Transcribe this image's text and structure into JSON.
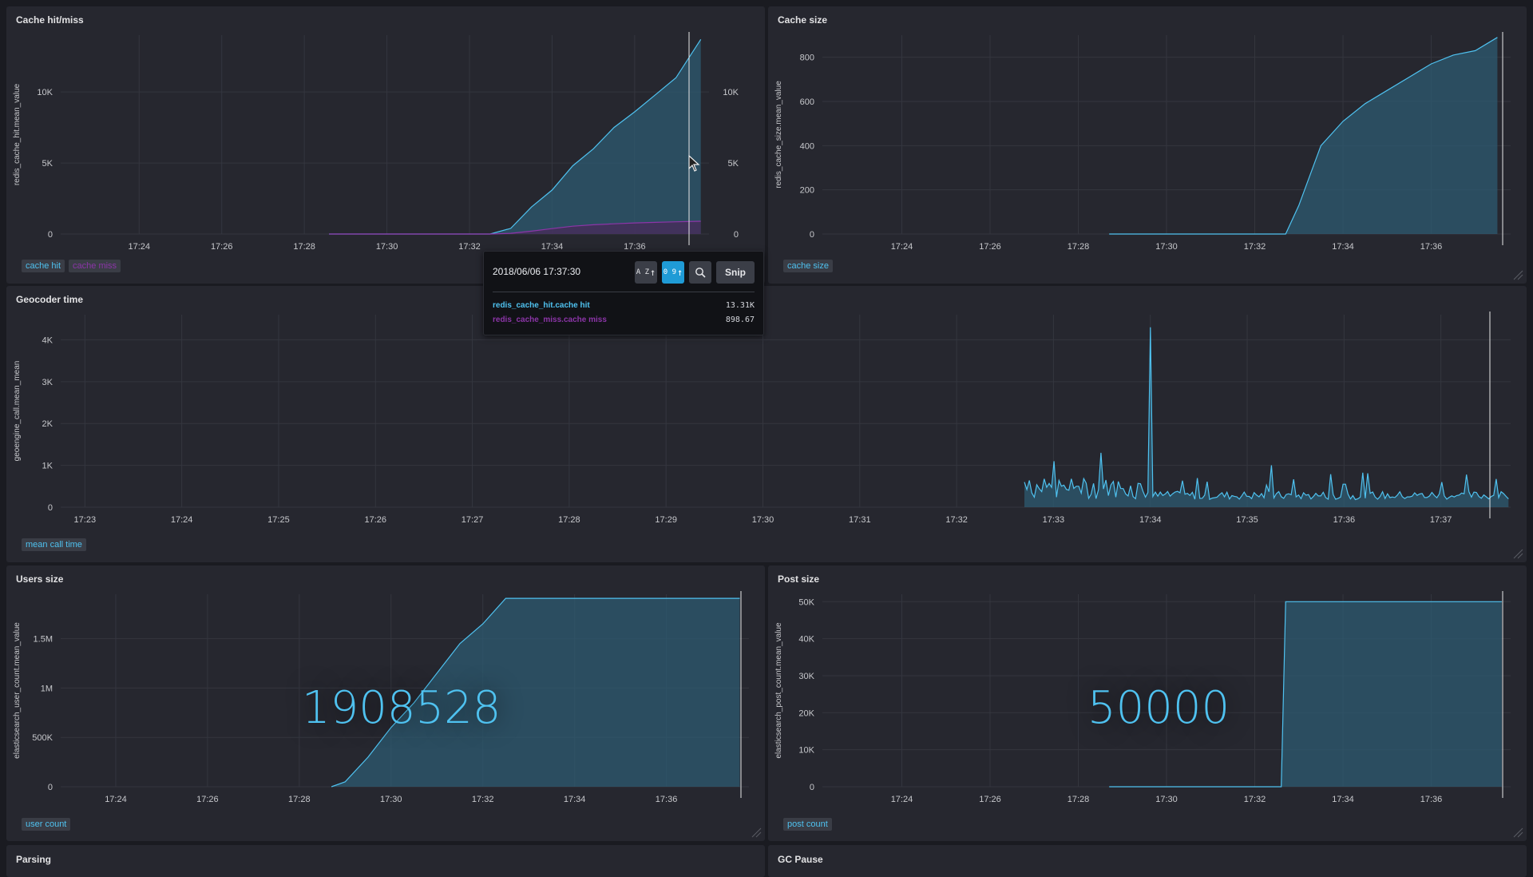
{
  "colors": {
    "series_blue": "#4fc2f0",
    "series_purple": "#8c35a8",
    "fill_blue": "#2e5b71",
    "fill_purple": "#4a2a5a",
    "grid": "#34363f",
    "axis_text": "#c7c8cc",
    "background": "#1a1b21",
    "panel": "#26272f"
  },
  "panels": {
    "cache_hit_miss": {
      "title": "Cache hit/miss",
      "y_axis_label": "redis_cache_hit.mean_value",
      "legend": [
        {
          "label": "cache hit",
          "color": "#4fc2f0"
        },
        {
          "label": "cache miss",
          "color": "#8c35a8"
        }
      ]
    },
    "cache_size": {
      "title": "Cache size",
      "y_axis_label": "redis_cache_size.mean_value",
      "legend": [
        {
          "label": "cache size",
          "color": "#4fc2f0"
        }
      ]
    },
    "geocoder_time": {
      "title": "Geocoder time",
      "y_axis_label": "geoengine_call.mean_mean",
      "legend": [
        {
          "label": "mean call time",
          "color": "#4fc2f0"
        }
      ]
    },
    "users_size": {
      "title": "Users size",
      "y_axis_label": "elasticsearch_user_count.mean_value",
      "big_number": "1908528",
      "legend": [
        {
          "label": "user count",
          "color": "#4fc2f0"
        }
      ]
    },
    "post_size": {
      "title": "Post size",
      "y_axis_label": "elasticsearch_post_count.mean_value",
      "big_number": "50000",
      "legend": [
        {
          "label": "post count",
          "color": "#4fc2f0"
        }
      ]
    },
    "parsing": {
      "title": "Parsing"
    },
    "gc_pause": {
      "title": "GC Pause"
    }
  },
  "tooltip": {
    "timestamp": "2018/06/06 17:37:30",
    "sort_alpha_label": "A Z",
    "sort_numeric_label": "0 9",
    "search_icon": "search-icon",
    "snip_label": "Snip",
    "rows": [
      {
        "name": "redis_cache_hit.cache hit",
        "value": "13.31K",
        "color": "#4fc2f0"
      },
      {
        "name": "redis_cache_miss.cache miss",
        "value": "898.67",
        "color": "#8c35a8"
      }
    ]
  },
  "chart_data": [
    {
      "type": "area",
      "title": "Cache hit/miss",
      "ylabel": "redis_cache_hit.mean_value",
      "x_ticks": [
        "17:24",
        "17:26",
        "17:28",
        "17:30",
        "17:32",
        "17:34",
        "17:36"
      ],
      "y_ticks": [
        "0",
        "5K",
        "10K"
      ],
      "y2_ticks": [
        "0",
        "5K",
        "10K"
      ],
      "ylim": [
        0,
        14000
      ],
      "x": [
        "17:22.9",
        "17:28.6",
        "17:31",
        "17:32.5",
        "17:33",
        "17:33.5",
        "17:34",
        "17:34.5",
        "17:35",
        "17:35.5",
        "17:36",
        "17:36.5",
        "17:37",
        "17:37.6"
      ],
      "series": [
        {
          "name": "cache hit",
          "values": [
            null,
            0,
            0,
            0,
            400,
            1900,
            3100,
            4800,
            6000,
            7500,
            8600,
            9800,
            11000,
            13700
          ]
        },
        {
          "name": "cache miss",
          "values": [
            null,
            0,
            0,
            0,
            50,
            200,
            380,
            550,
            650,
            720,
            780,
            820,
            860,
            900
          ]
        }
      ]
    },
    {
      "type": "area",
      "title": "Cache size",
      "ylabel": "redis_cache_size.mean_value",
      "x_ticks": [
        "17:24",
        "17:26",
        "17:28",
        "17:30",
        "17:32",
        "17:34",
        "17:36"
      ],
      "y_ticks": [
        "0",
        "200",
        "400",
        "600",
        "800"
      ],
      "ylim": [
        0,
        900
      ],
      "x": [
        "17:28.7",
        "17:32.7",
        "17:33",
        "17:33.5",
        "17:34",
        "17:34.5",
        "17:35",
        "17:35.5",
        "17:36",
        "17:36.5",
        "17:37",
        "17:37.5"
      ],
      "series": [
        {
          "name": "cache size",
          "values": [
            0,
            0,
            130,
            400,
            510,
            590,
            650,
            710,
            770,
            810,
            830,
            890
          ]
        }
      ]
    },
    {
      "type": "line",
      "title": "Geocoder time",
      "ylabel": "geoengine_call.mean_mean",
      "x_ticks": [
        "17:23",
        "17:24",
        "17:25",
        "17:26",
        "17:27",
        "17:28",
        "17:29",
        "17:30",
        "17:31",
        "17:32",
        "17:33",
        "17:34",
        "17:35",
        "17:36",
        "17:37"
      ],
      "y_ticks": [
        "0",
        "1K",
        "2K",
        "3K",
        "4K"
      ],
      "ylim": [
        0,
        4600
      ],
      "x": [
        "17:32.7",
        "17:33",
        "17:33.25",
        "17:33.5",
        "17:33.8",
        "17:34",
        "17:34.5",
        "17:35",
        "17:35.25",
        "17:35.5",
        "17:36",
        "17:36.5",
        "17:37",
        "17:37.7"
      ],
      "series": [
        {
          "name": "mean call time",
          "values": [
            600,
            1100,
            500,
            1300,
            350,
            4300,
            250,
            200,
            1000,
            200,
            550,
            180,
            600,
            250
          ]
        }
      ]
    },
    {
      "type": "area",
      "title": "Users size",
      "ylabel": "elasticsearch_user_count.mean_value",
      "x_ticks": [
        "17:24",
        "17:26",
        "17:28",
        "17:30",
        "17:32",
        "17:34",
        "17:36"
      ],
      "y_ticks": [
        "0",
        "500K",
        "1M",
        "1.5M"
      ],
      "ylim": [
        0,
        1950000
      ],
      "x": [
        "17:28.7",
        "17:29",
        "17:29.5",
        "17:30",
        "17:30.5",
        "17:31",
        "17:31.5",
        "17:32",
        "17:32.5",
        "17:37.6"
      ],
      "series": [
        {
          "name": "user count",
          "values": [
            0,
            50000,
            300000,
            600000,
            850000,
            1150000,
            1450000,
            1650000,
            1908528,
            1908528
          ]
        }
      ]
    },
    {
      "type": "area",
      "title": "Post size",
      "ylabel": "elasticsearch_post_count.mean_value",
      "x_ticks": [
        "17:24",
        "17:26",
        "17:28",
        "17:30",
        "17:32",
        "17:34",
        "17:36"
      ],
      "y_ticks": [
        "0",
        "10K",
        "20K",
        "30K",
        "40K",
        "50K"
      ],
      "ylim": [
        0,
        52000
      ],
      "x": [
        "17:28.7",
        "17:32.6",
        "17:32.7",
        "17:37.6"
      ],
      "series": [
        {
          "name": "post count",
          "values": [
            0,
            0,
            50000,
            50000
          ]
        }
      ]
    }
  ]
}
